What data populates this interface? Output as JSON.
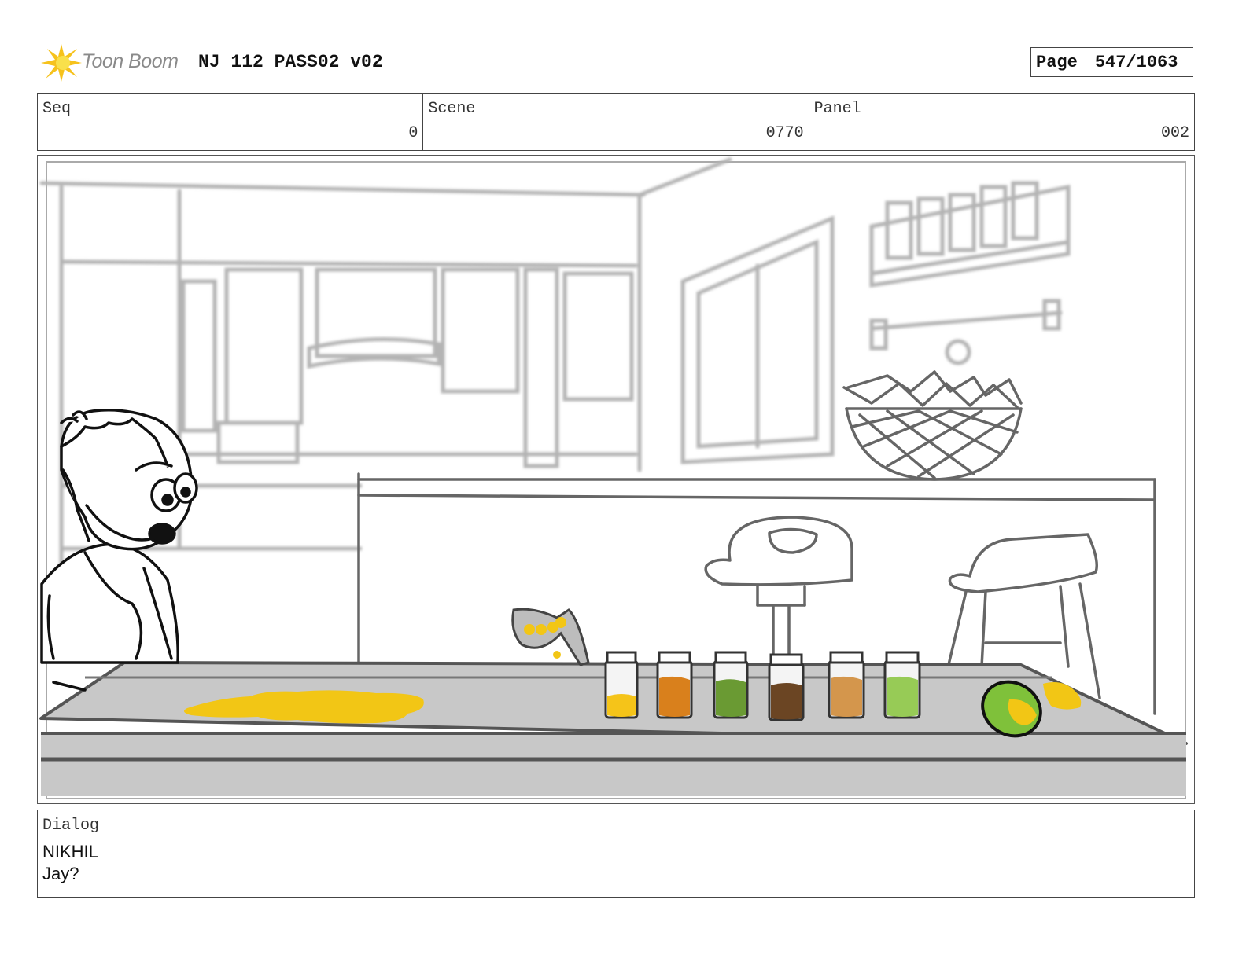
{
  "header": {
    "logo_text": "Toon Boom",
    "document_title": "NJ 112 PASS02 v02",
    "page_label": "Page",
    "page_number": "547/1063"
  },
  "meta": {
    "seq_label": "Seq",
    "seq_value": "0",
    "scene_label": "Scene",
    "scene_value": "0770",
    "panel_label": "Panel",
    "panel_value": "002"
  },
  "panel": {
    "drawing": "storyboard-sketch",
    "colors": {
      "spill": "#f2c615",
      "counter": "#c8c8c8",
      "jar_yellow": "#f5c419",
      "jar_orange": "#d9801c",
      "jar_green": "#6a9a33",
      "jar_brown": "#6b4523",
      "jar_tan": "#d4964c",
      "jar_lightgreen": "#97cb56",
      "mango": "#7fc13a"
    }
  },
  "dialog": {
    "label": "Dialog",
    "character": "NIKHIL",
    "line": "Jay?"
  }
}
